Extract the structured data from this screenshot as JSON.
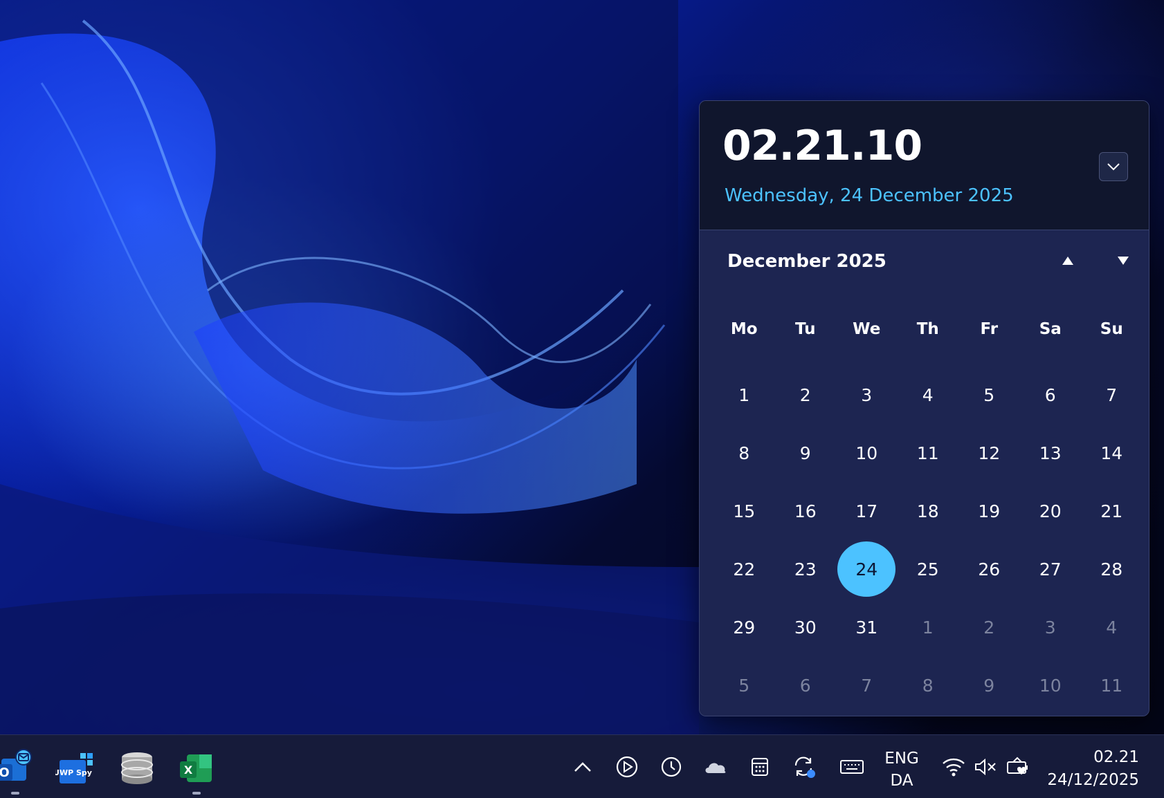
{
  "flyout": {
    "time": "02.21.10",
    "full_date": "Wednesday, 24 December 2025"
  },
  "calendar": {
    "month_title": "December 2025",
    "weekdays": [
      "Mo",
      "Tu",
      "We",
      "Th",
      "Fr",
      "Sa",
      "Su"
    ],
    "weeks": [
      [
        {
          "d": "1"
        },
        {
          "d": "2"
        },
        {
          "d": "3"
        },
        {
          "d": "4"
        },
        {
          "d": "5"
        },
        {
          "d": "6"
        },
        {
          "d": "7"
        }
      ],
      [
        {
          "d": "8"
        },
        {
          "d": "9"
        },
        {
          "d": "10"
        },
        {
          "d": "11"
        },
        {
          "d": "12"
        },
        {
          "d": "13"
        },
        {
          "d": "14"
        }
      ],
      [
        {
          "d": "15"
        },
        {
          "d": "16"
        },
        {
          "d": "17"
        },
        {
          "d": "18"
        },
        {
          "d": "19"
        },
        {
          "d": "20"
        },
        {
          "d": "21"
        }
      ],
      [
        {
          "d": "22"
        },
        {
          "d": "23"
        },
        {
          "d": "24",
          "today": true
        },
        {
          "d": "25"
        },
        {
          "d": "26"
        },
        {
          "d": "27"
        },
        {
          "d": "28"
        }
      ],
      [
        {
          "d": "29"
        },
        {
          "d": "30"
        },
        {
          "d": "31"
        },
        {
          "d": "1",
          "muted": true
        },
        {
          "d": "2",
          "muted": true
        },
        {
          "d": "3",
          "muted": true
        },
        {
          "d": "4",
          "muted": true
        }
      ],
      [
        {
          "d": "5",
          "muted": true
        },
        {
          "d": "6",
          "muted": true
        },
        {
          "d": "7",
          "muted": true
        },
        {
          "d": "8",
          "muted": true
        },
        {
          "d": "9",
          "muted": true
        },
        {
          "d": "10",
          "muted": true
        },
        {
          "d": "11",
          "muted": true
        }
      ]
    ],
    "accent_color": "#4cc2ff"
  },
  "taskbar": {
    "apps": [
      {
        "name": "outlook-app-icon",
        "badge_text": "O"
      },
      {
        "name": "uwp-spy-app-icon",
        "badge_text": "UWP Spy"
      },
      {
        "name": "database-app-icon"
      },
      {
        "name": "excel-app-icon",
        "badge_text": "X"
      }
    ],
    "tray": [
      "chevron-up-icon",
      "media-play-icon",
      "clock-icon",
      "onedrive-cloud-icon",
      "calculator-icon",
      "sync-icon",
      "keyboard-icon"
    ],
    "language_top": "ENG",
    "language_bottom": "DA",
    "status_icons": [
      "wifi-icon",
      "speaker-muted-icon",
      "battery-saver-icon"
    ],
    "clock_time": "02.21",
    "clock_date": "24/12/2025"
  }
}
